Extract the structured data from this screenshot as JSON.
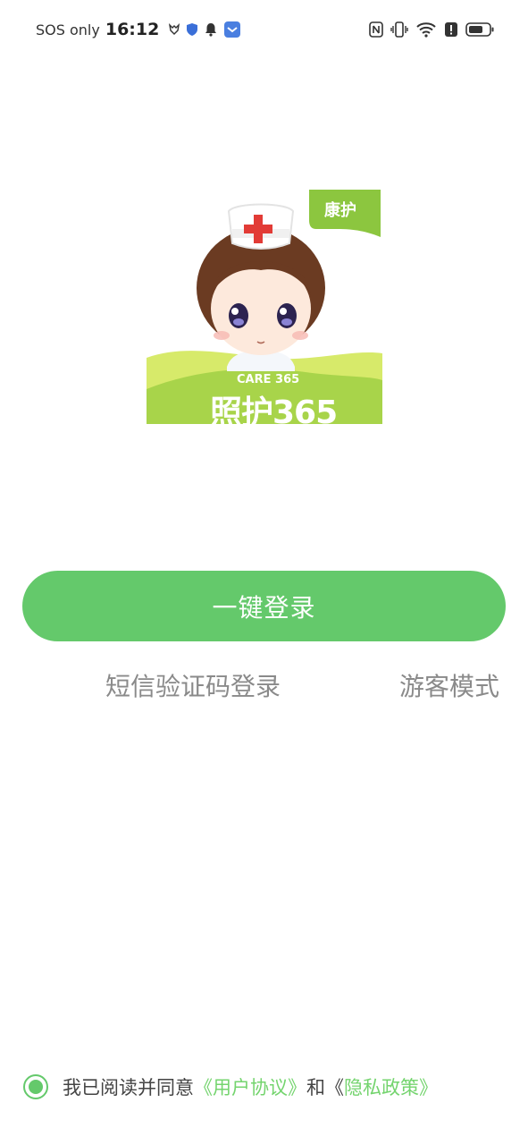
{
  "status_bar": {
    "network_text": "SOS only",
    "time": "16:12",
    "icons_left": [
      "wolf-icon",
      "shield-icon",
      "bell-icon",
      "app-icon"
    ],
    "icons_right": [
      "nfc-icon",
      "vibrate-icon",
      "wifi-icon",
      "alert-icon",
      "battery-icon"
    ]
  },
  "logo": {
    "tag": "康护",
    "brand_en": "CARE 365",
    "brand_cn": "照护365",
    "brand_color": "#9bcf3e"
  },
  "login": {
    "primary_label": "一键登录",
    "sms_label": "短信验证码登录",
    "guest_label": "游客模式"
  },
  "agreement": {
    "checked": true,
    "prefix": "我已阅读并同意",
    "user_agreement": "《用户协议》",
    "connector": "和",
    "privacy_open": "《",
    "privacy_policy": "隐私政策》"
  },
  "colors": {
    "accent": "#64c96b",
    "link_green": "#74d46e",
    "muted_text": "#8a8a8a"
  }
}
